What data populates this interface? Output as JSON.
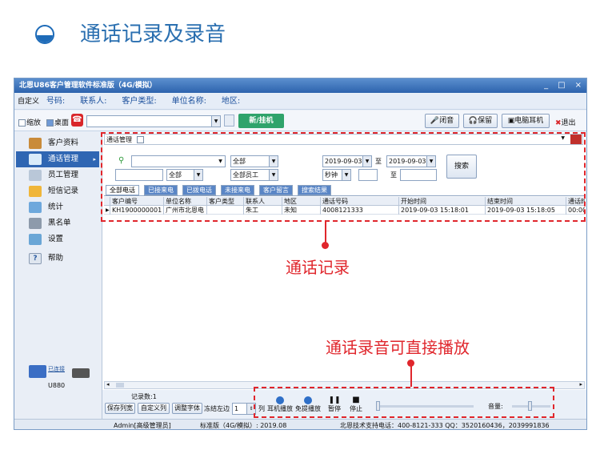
{
  "slide": {
    "title": "通话记录及录音"
  },
  "window": {
    "title": "北恩U86客户管理软件标准版（4G/模拟）",
    "controls": [
      "_",
      "□",
      "×"
    ]
  },
  "fieldbar": {
    "custom": "自定义",
    "fields": [
      "号码:",
      "联系人:",
      "客户类型:",
      "单位名称:",
      "地区:"
    ]
  },
  "toolbar": {
    "zoom": "缩放",
    "desktop": "桌面",
    "newhang": "新/挂机",
    "mute": "闭音",
    "hold": "保留",
    "headset": "电脑耳机",
    "exit": "退出"
  },
  "sidebar": {
    "items": [
      "客户资料",
      "通话管理",
      "员工管理",
      "短信记录",
      "统计",
      "黑名单",
      "设置",
      "帮助"
    ],
    "status": "已连接",
    "device": "U880"
  },
  "panel": {
    "header": "通话管理",
    "type_all": "全部",
    "staff_all": "全部员工",
    "all": "全部",
    "date_from": "2019-09-03",
    "date_to": "2019-09-03",
    "to": "至",
    "to2": "至",
    "unit": "秒钟",
    "search": "搜索"
  },
  "tabs": [
    "全部电话",
    "已接来电",
    "已拨电话",
    "未接来电",
    "客户留言",
    "搜索结果"
  ],
  "grid": {
    "headers": [
      "客户编号",
      "单位名称",
      "客户类型",
      "联系人",
      "地区",
      "通话号码",
      "开始时间",
      "结束时间",
      "通话时"
    ],
    "rows": [
      [
        "KH1900000001",
        "广州市北恩电",
        "",
        "朱工",
        "未知",
        "4008121333",
        "2019-09-03  15:18:01",
        "2019-09-03  15:18:05",
        "00:00"
      ]
    ]
  },
  "bottom": {
    "count": "记录数:1",
    "buttons": [
      "保存列宽",
      "自定义列",
      "调整字体",
      "冻结左边",
      "1",
      "列"
    ],
    "play": [
      "耳机播放",
      "免提播放",
      "暂停",
      "停止"
    ],
    "volume": "音量:"
  },
  "statusbar": {
    "user": "Admin[高级管理员]",
    "version": "标准版（4G/模拟）: 2019.08",
    "support": "北恩技术支持电话：400-8121-333  QQ：3520160436，2039991836"
  },
  "annotations": {
    "record": "通话记录",
    "recording": "通话录音可直接播放"
  },
  "colors": {
    "accent": "#2f66b3",
    "annotation": "#e0262c",
    "newbtn": "#2fa36b"
  }
}
